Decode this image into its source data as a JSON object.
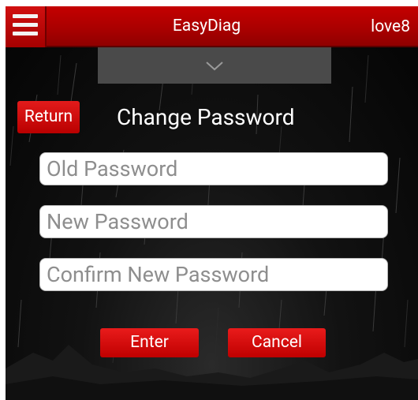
{
  "header": {
    "title": "EasyDiag",
    "user": "love8",
    "menu_icon": "hamburger-menu-icon"
  },
  "dropdown": {
    "icon": "chevron-down-icon"
  },
  "page": {
    "return_label": "Return",
    "title": "Change Password"
  },
  "form": {
    "old_password_placeholder": "Old Password",
    "new_password_placeholder": "New Password",
    "confirm_password_placeholder": "Confirm New Password",
    "enter_label": "Enter",
    "cancel_label": "Cancel"
  },
  "colors": {
    "accent_red": "#c40000",
    "background": "#0b0b0b"
  }
}
